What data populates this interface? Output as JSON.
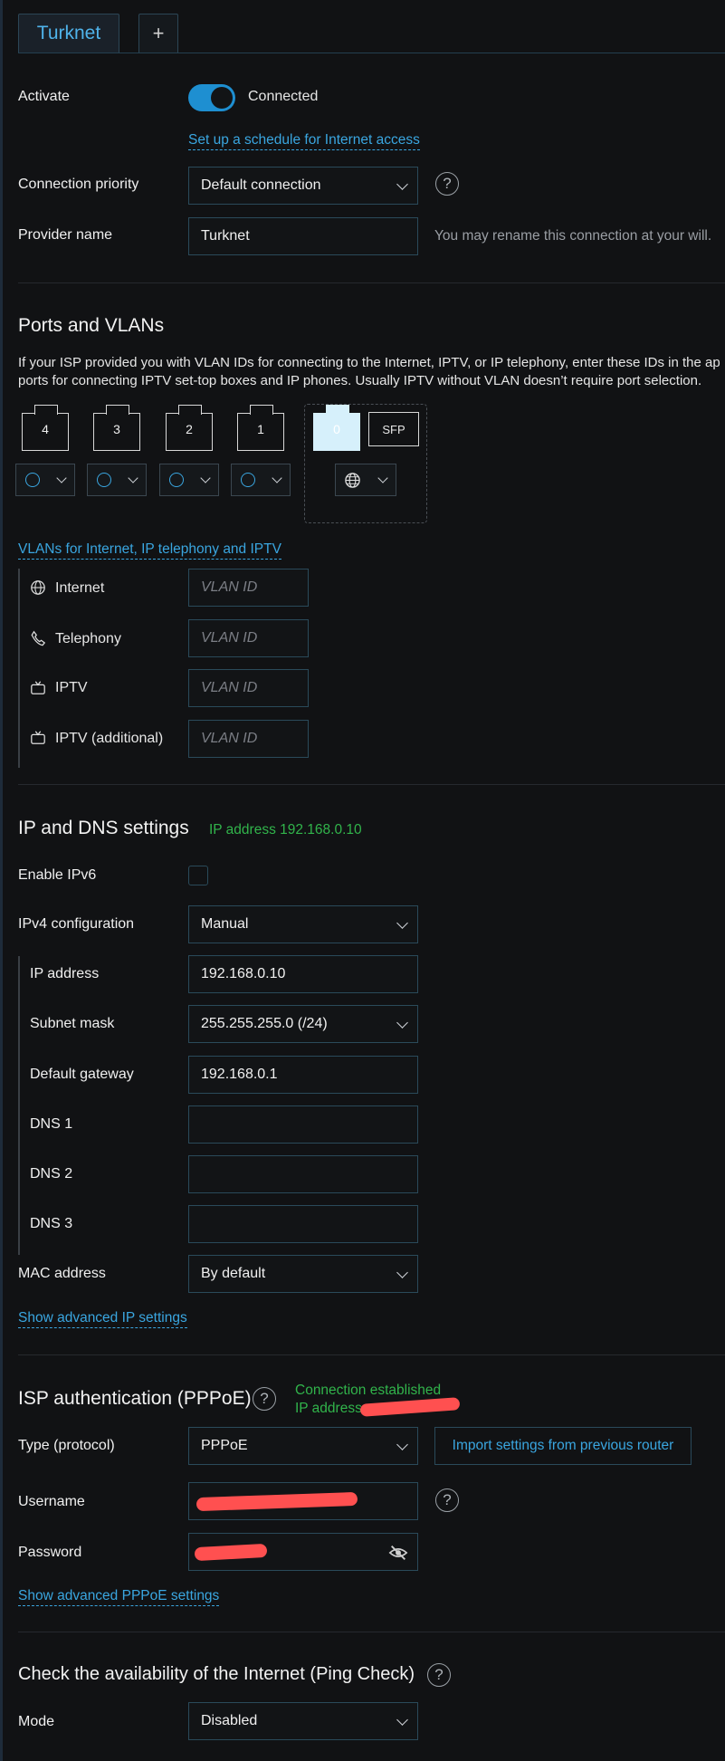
{
  "tabs": {
    "active": "Turknet",
    "add": "+"
  },
  "general": {
    "activate_label": "Activate",
    "activate_state": "Connected",
    "schedule_link": "Set up a schedule for Internet access",
    "priority_label": "Connection priority",
    "priority_value": "Default connection",
    "help": "?",
    "provider_label": "Provider name",
    "provider_value": "Turknet",
    "provider_hint": "You may rename this connection at your will."
  },
  "ports": {
    "title": "Ports and VLANs",
    "desc1": "If your ISP provided you with VLAN IDs for connecting to the Internet, IPTV, or IP telephony, enter these IDs in the ap",
    "desc2": "ports for connecting IPTV set-top boxes and IP phones. Usually IPTV without VLAN doesn’t require port selection.",
    "port_numbers": [
      "4",
      "3",
      "2",
      "1",
      "0"
    ],
    "sfp": "SFP",
    "vlans_link": "VLANs for Internet, IP telephony and IPTV",
    "vlan_rows": [
      "Internet",
      "Telephony",
      "IPTV",
      "IPTV (additional)"
    ],
    "vlan_placeholder": "VLAN ID"
  },
  "ip": {
    "title": "IP and DNS settings",
    "status": "IP address 192.168.0.10",
    "ipv6_label": "Enable IPv6",
    "ipv4_label": "IPv4 configuration",
    "ipv4_value": "Manual",
    "ip_label": "IP address",
    "ip_value": "192.168.0.10",
    "mask_label": "Subnet mask",
    "mask_value": "255.255.255.0 (/24)",
    "gw_label": "Default gateway",
    "gw_value": "192.168.0.1",
    "dns1_label": "DNS 1",
    "dns2_label": "DNS 2",
    "dns3_label": "DNS 3",
    "mac_label": "MAC address",
    "mac_value": "By default",
    "advanced_link": "Show advanced IP settings"
  },
  "pppoe": {
    "title": "ISP authentication (PPPoE)",
    "status1": "Connection established",
    "status2": "IP address",
    "type_label": "Type (protocol)",
    "type_value": "PPPoE",
    "import_button": "Import settings from previous router",
    "username_label": "Username",
    "password_label": "Password",
    "advanced_link": "Show advanced PPPoE settings"
  },
  "ping": {
    "title": "Check the availability of the Internet (Ping Check)",
    "mode_label": "Mode",
    "mode_value": "Disabled"
  }
}
